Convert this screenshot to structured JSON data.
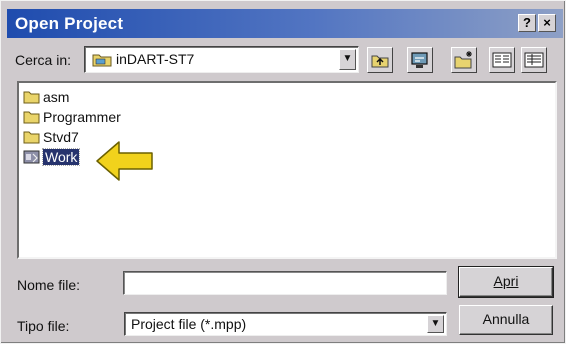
{
  "window": {
    "title": "Open Project",
    "help_glyph": "?",
    "close_glyph": "×"
  },
  "look_in": {
    "label": "Cerca in:",
    "value": "inDART-ST7",
    "icon": "folder-icon"
  },
  "toolbar": [
    {
      "name": "up-one-level-button",
      "icon": "folder-up-icon"
    },
    {
      "name": "desktop-button",
      "icon": "desktop-icon"
    },
    {
      "name": "new-folder-button",
      "icon": "new-folder-icon"
    },
    {
      "name": "list-view-button",
      "icon": "list-view-icon"
    },
    {
      "name": "details-view-button",
      "icon": "details-view-icon"
    }
  ],
  "files": [
    {
      "name": "asm",
      "icon": "folder-icon",
      "selected": false
    },
    {
      "name": "Programmer",
      "icon": "folder-icon",
      "selected": false
    },
    {
      "name": "Stvd7",
      "icon": "folder-icon",
      "selected": false
    },
    {
      "name": "Work",
      "icon": "project-file-icon",
      "selected": true
    }
  ],
  "filename": {
    "label": "Nome file:",
    "value": ""
  },
  "filetype": {
    "label": "Tipo file:",
    "value": "Project file (*.mpp)"
  },
  "buttons": {
    "open": "Apri",
    "cancel": "Annulla"
  },
  "colors": {
    "titlebar_start": "#1f4cae",
    "selection": "#26336d",
    "arrow": "#f1d21c"
  }
}
